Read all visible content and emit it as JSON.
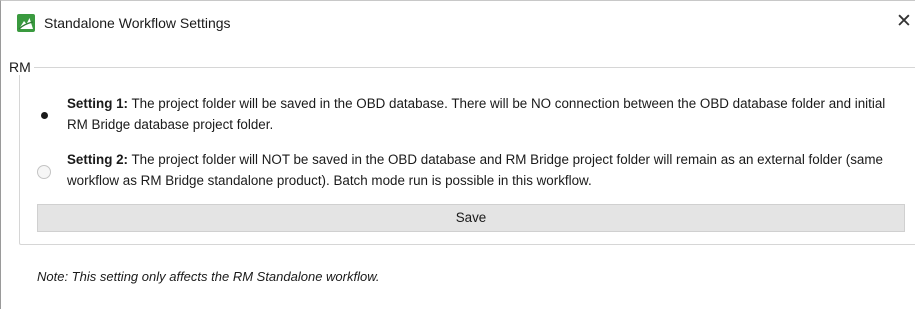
{
  "window": {
    "title": "Standalone Workflow Settings",
    "close_glyph": "✕",
    "app_icon": "rm-bridge-app-icon",
    "accent_color": "#3a9a3f"
  },
  "group": {
    "label": "RM"
  },
  "options": [
    {
      "label": "Setting 1:",
      "description": " The project folder will be saved in the OBD database. There will be NO connection between the OBD database folder and initial RM Bridge database project folder.",
      "selected": true
    },
    {
      "label": "Setting 2:",
      "description": " The project folder will NOT be saved in the OBD database and RM Bridge project folder will remain as an external folder (same workflow as RM Bridge standalone product). Batch mode run is possible in this workflow.",
      "selected": false
    }
  ],
  "save_button": {
    "label": "Save"
  },
  "note": "Note: This setting only affects the RM Standalone workflow."
}
